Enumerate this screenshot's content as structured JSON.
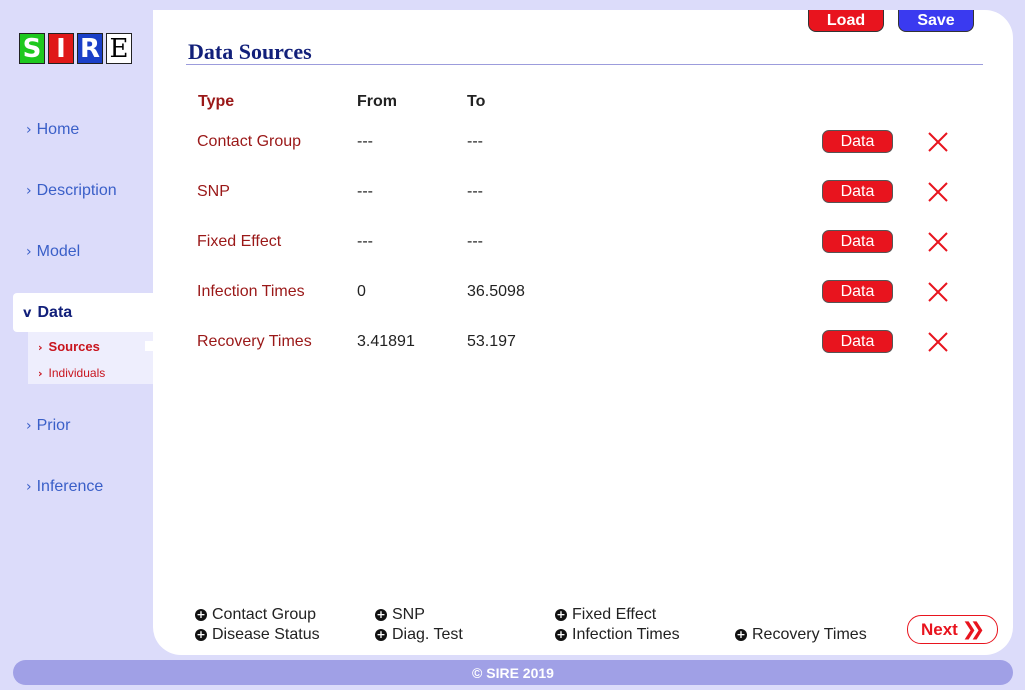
{
  "logo": {
    "letters": [
      "S",
      "I",
      "R",
      "E"
    ]
  },
  "nav": {
    "items": [
      {
        "label": "Home"
      },
      {
        "label": "Description"
      },
      {
        "label": "Model"
      },
      {
        "label": "Data"
      },
      {
        "label": "Prior"
      },
      {
        "label": "Inference"
      }
    ],
    "active": "Data",
    "sub_items": [
      {
        "label": "Sources"
      },
      {
        "label": "Individuals"
      }
    ],
    "active_sub": "Sources"
  },
  "toolbar": {
    "load_label": "Load",
    "save_label": "Save"
  },
  "page": {
    "title": "Data Sources"
  },
  "table": {
    "headers": {
      "type": "Type",
      "from": "From",
      "to": "To"
    },
    "rows": [
      {
        "type": "Contact Group",
        "from": "---",
        "to": "---",
        "button": "Data"
      },
      {
        "type": "SNP",
        "from": "---",
        "to": "---",
        "button": "Data"
      },
      {
        "type": "Fixed Effect",
        "from": "---",
        "to": "---",
        "button": "Data"
      },
      {
        "type": "Infection Times",
        "from": "0",
        "to": "36.5098",
        "button": "Data"
      },
      {
        "type": "Recovery Times",
        "from": "3.41891",
        "to": "53.197",
        "button": "Data"
      }
    ]
  },
  "add_sources": [
    {
      "label": "Contact Group"
    },
    {
      "label": "SNP"
    },
    {
      "label": "Fixed Effect"
    },
    {
      "label": "Disease Status"
    },
    {
      "label": "Diag. Test"
    },
    {
      "label": "Infection Times"
    },
    {
      "label": "Recovery Times"
    }
  ],
  "next": {
    "label": "Next"
  },
  "footer": {
    "text": "© SIRE 2019"
  },
  "colors": {
    "background": "#dcdcfa",
    "accent_red": "#e8141e",
    "accent_blue": "#3a3af0",
    "title_blue": "#12207a",
    "type_red": "#9a1818",
    "footer": "#a0a0e6"
  }
}
